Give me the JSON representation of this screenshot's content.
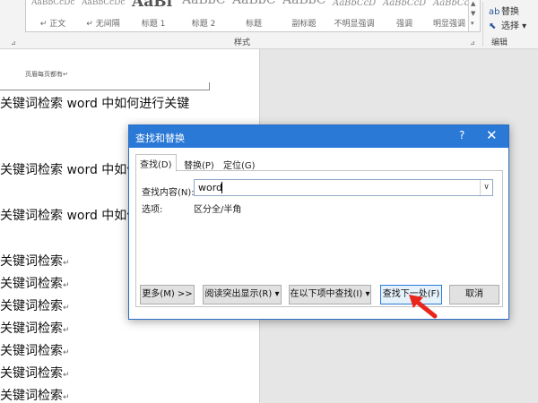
{
  "ribbon": {
    "style_gallery": [
      {
        "preview": "AaBbCcDc",
        "name": "↵ 正文",
        "size": 9
      },
      {
        "preview": "AaBbCcDc",
        "name": "↵ 无间隔",
        "size": 9
      },
      {
        "preview": "AaBl",
        "name": "标题 1",
        "size": 17
      },
      {
        "preview": "AaBbC",
        "name": "标题 2",
        "size": 14
      },
      {
        "preview": "AaBbC",
        "name": "标题",
        "size": 14
      },
      {
        "preview": "AaBbC",
        "name": "副标题",
        "size": 14
      },
      {
        "preview": "AaBbCcD",
        "name": "不明显强调",
        "size": 10
      },
      {
        "preview": "AaBbCcD",
        "name": "强调",
        "size": 10
      },
      {
        "preview": "AaBbCcD",
        "name": "明显强调",
        "size": 10
      }
    ],
    "styles_group_label": "样式",
    "edit_items": [
      "替换",
      "选择 ▾"
    ],
    "edit_group_label": "编辑"
  },
  "document": {
    "header_text": "页眉每页都有↵",
    "lines": [
      "关键词检索 word 中如何进行关键",
      "关键词检索 word 中如何",
      "关键词检索 word 中如何",
      "关键词检索",
      "关键词检索",
      "关键词检索",
      "关键词检索",
      "关键词检索",
      "关键词检索",
      "关键词检索"
    ]
  },
  "dialog": {
    "title": "查找和替换",
    "help": "?",
    "close": "✕",
    "tabs": [
      "查找(D)",
      "替换(P)",
      "定位(G)"
    ],
    "find_label": "查找内容(N):",
    "find_value": "word",
    "options_label": "选项:",
    "options_value": "区分全/半角",
    "buttons": {
      "more": "更多(M) >>",
      "reading_highlight": "阅读突出显示(R) ▾",
      "find_in": "在以下项中查找(I) ▾",
      "find_next": "查找下一处(F)",
      "cancel": "取消"
    }
  },
  "colors": {
    "titlebar": "#2b79d7",
    "annotation_arrow": "#e8261c"
  }
}
